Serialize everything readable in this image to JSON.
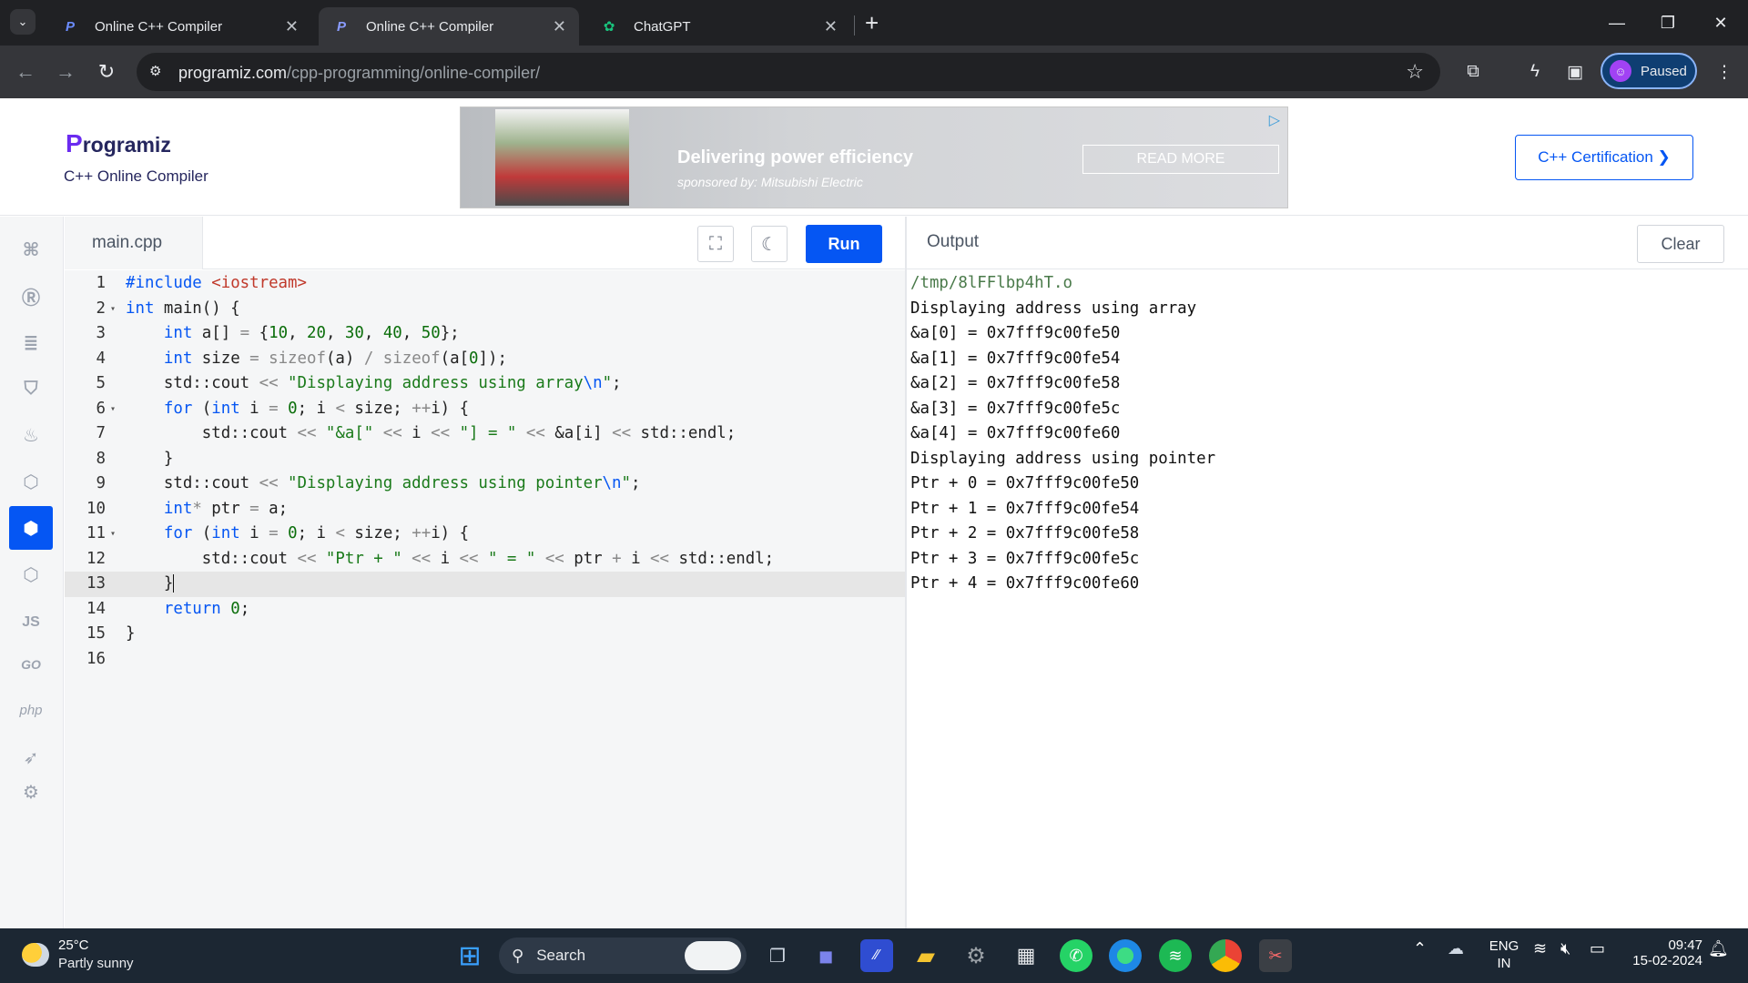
{
  "browser": {
    "tabs": [
      {
        "title": "Online C++ Compiler",
        "favicon": "programiz-icon"
      },
      {
        "title": "Online C++ Compiler",
        "favicon": "programiz-icon",
        "active": true
      },
      {
        "title": "ChatGPT",
        "favicon": "chatgpt-icon"
      }
    ],
    "url_host": "programiz.com",
    "url_path": "/cpp-programming/online-compiler/",
    "profile_label": "Paused"
  },
  "site": {
    "logo": "rogramiz",
    "logo_letter": "P",
    "subtitle": "C++ Online Compiler",
    "certification_button": "C++ Certification ❯"
  },
  "ad": {
    "headline": "Delivering power efficiency",
    "sponsor": "sponsored by: Mitsubishi Electric",
    "cta": "READ MORE"
  },
  "rail": {
    "items": [
      "python-icon",
      "r-icon",
      "sql-icon",
      "html5-icon",
      "java-icon",
      "c-icon",
      "cpp-icon",
      "csharp-icon",
      "js-icon",
      "go-icon",
      "php-icon",
      "swift-icon",
      "rust-icon"
    ],
    "labels": {
      "js": "JS",
      "go": "GO",
      "php": "php"
    },
    "active": "cpp-icon"
  },
  "editor": {
    "filename": "main.cpp",
    "run_label": "Run",
    "cursor_line": 13,
    "lines": [
      "#include <iostream>",
      "int main() {",
      "    int a[] = {10, 20, 30, 40, 50};",
      "    int size = sizeof(a) / sizeof(a[0]);",
      "    std::cout << \"Displaying address using array\\n\";",
      "    for (int i = 0; i < size; ++i) {",
      "        std::cout << \"&a[\" << i << \"] = \" << &a[i] << std::endl;",
      "    }",
      "    std::cout << \"Displaying address using pointer\\n\";",
      "    int* ptr = a;",
      "    for (int i = 0; i < size; ++i) {",
      "        std::cout << \"Ptr + \" << i << \" = \" << ptr + i << std::endl;",
      "    }",
      "    return 0;",
      "}",
      ""
    ]
  },
  "output": {
    "title": "Output",
    "clear_label": "Clear",
    "lines": [
      "/tmp/8lFFlbp4hT.o",
      "Displaying address using array",
      "&a[0] = 0x7fff9c00fe50",
      "&a[1] = 0x7fff9c00fe54",
      "&a[2] = 0x7fff9c00fe58",
      "&a[3] = 0x7fff9c00fe5c",
      "&a[4] = 0x7fff9c00fe60",
      "Displaying address using pointer",
      "Ptr + 0 = 0x7fff9c00fe50",
      "Ptr + 1 = 0x7fff9c00fe54",
      "Ptr + 2 = 0x7fff9c00fe58",
      "Ptr + 3 = 0x7fff9c00fe5c",
      "Ptr + 4 = 0x7fff9c00fe60"
    ]
  },
  "taskbar": {
    "temperature": "25°C",
    "weather": "Partly sunny",
    "search_placeholder": "Search",
    "language": "ENG",
    "region": "IN",
    "time": "09:47",
    "date": "15-02-2024"
  },
  "colors": {
    "accent": "#0556f3",
    "keyword": "#0556f3",
    "string": "#1a7a1a",
    "include": "#c0392b"
  }
}
